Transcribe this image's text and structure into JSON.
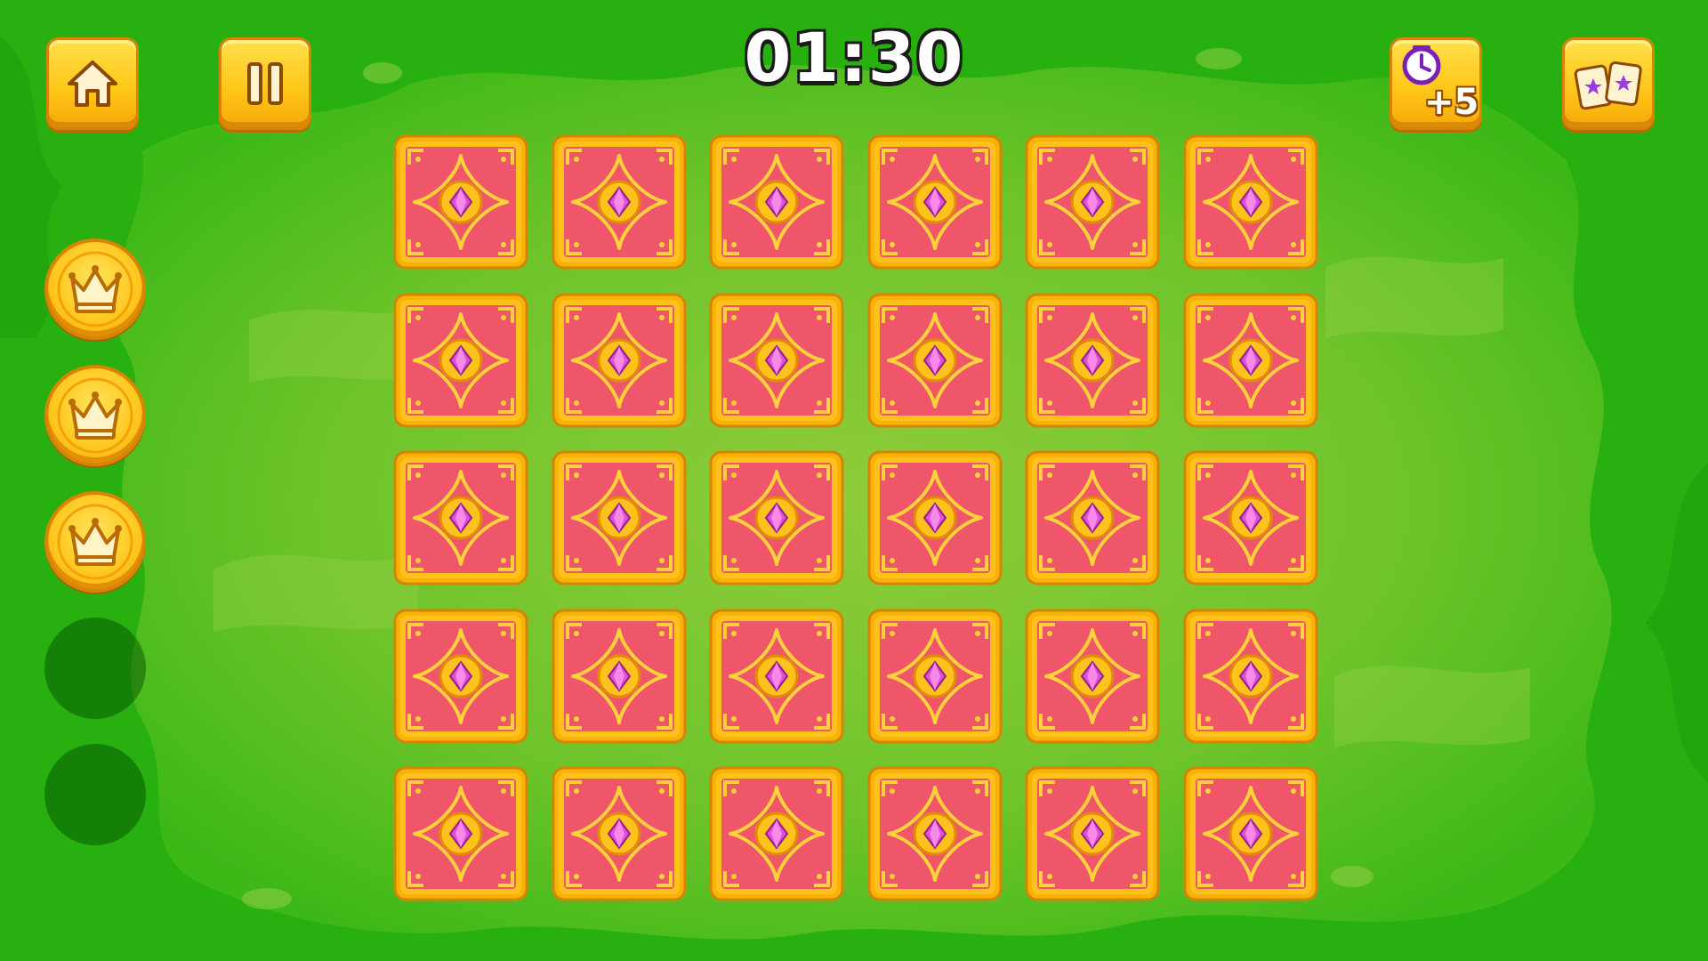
{
  "hud": {
    "timer": "01:30",
    "home_button": {
      "icon": "home-icon"
    },
    "pause_button": {
      "icon": "pause-icon"
    },
    "time_bonus_button": {
      "icon": "clock-icon",
      "label": "+5"
    },
    "reveal_cards_button": {
      "icon": "star-cards-icon"
    }
  },
  "crowns": {
    "earned": 3,
    "total": 5,
    "icon": "crown-icon"
  },
  "board": {
    "rows": 5,
    "columns": 6,
    "card_state": "face-down",
    "card_back_icon": "gem-emblem-icon"
  },
  "colors": {
    "background": "#2fb311",
    "card_back": "#f0566a",
    "card_frame": "#ffc21c",
    "gem": "#e14fd6",
    "button": "#ffc71a"
  }
}
